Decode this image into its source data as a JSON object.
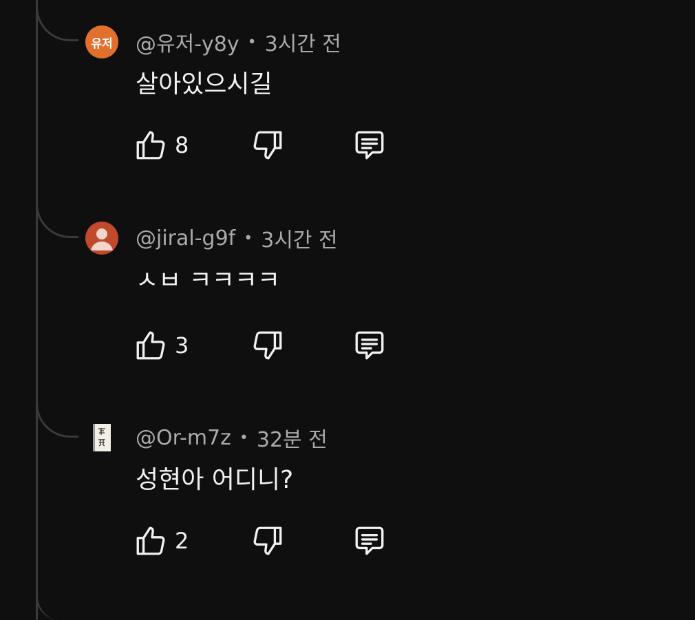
{
  "comments": [
    {
      "handle": "@유저-y8y",
      "dot": "•",
      "time": "3시간 전",
      "text": "살아있으시길",
      "likes": "8",
      "avatar": {
        "type": "initials",
        "label": "유저",
        "color": "#e0702c"
      }
    },
    {
      "handle": "@jiral-g9f",
      "dot": "•",
      "time": "3시간 전",
      "text": "ㅅㅂ ㅋㅋㅋㅋ",
      "likes": "3",
      "avatar": {
        "type": "default-person",
        "color": "#c04a2b"
      }
    },
    {
      "handle": "@Or-m7z",
      "dot": "•",
      "time": "32분 전",
      "text": "성현아 어디니?",
      "likes": "2",
      "avatar": {
        "type": "image",
        "description": "paper-scroll-icon"
      }
    }
  ],
  "icons": {
    "like": "thumbs-up-icon",
    "dislike": "thumbs-down-icon",
    "reply": "reply-comment-icon"
  },
  "colors": {
    "background": "#0f0f0f",
    "thread_line": "#3a3a3a",
    "meta_text": "#aaaaaa",
    "body_text": "#f1f1f1"
  }
}
